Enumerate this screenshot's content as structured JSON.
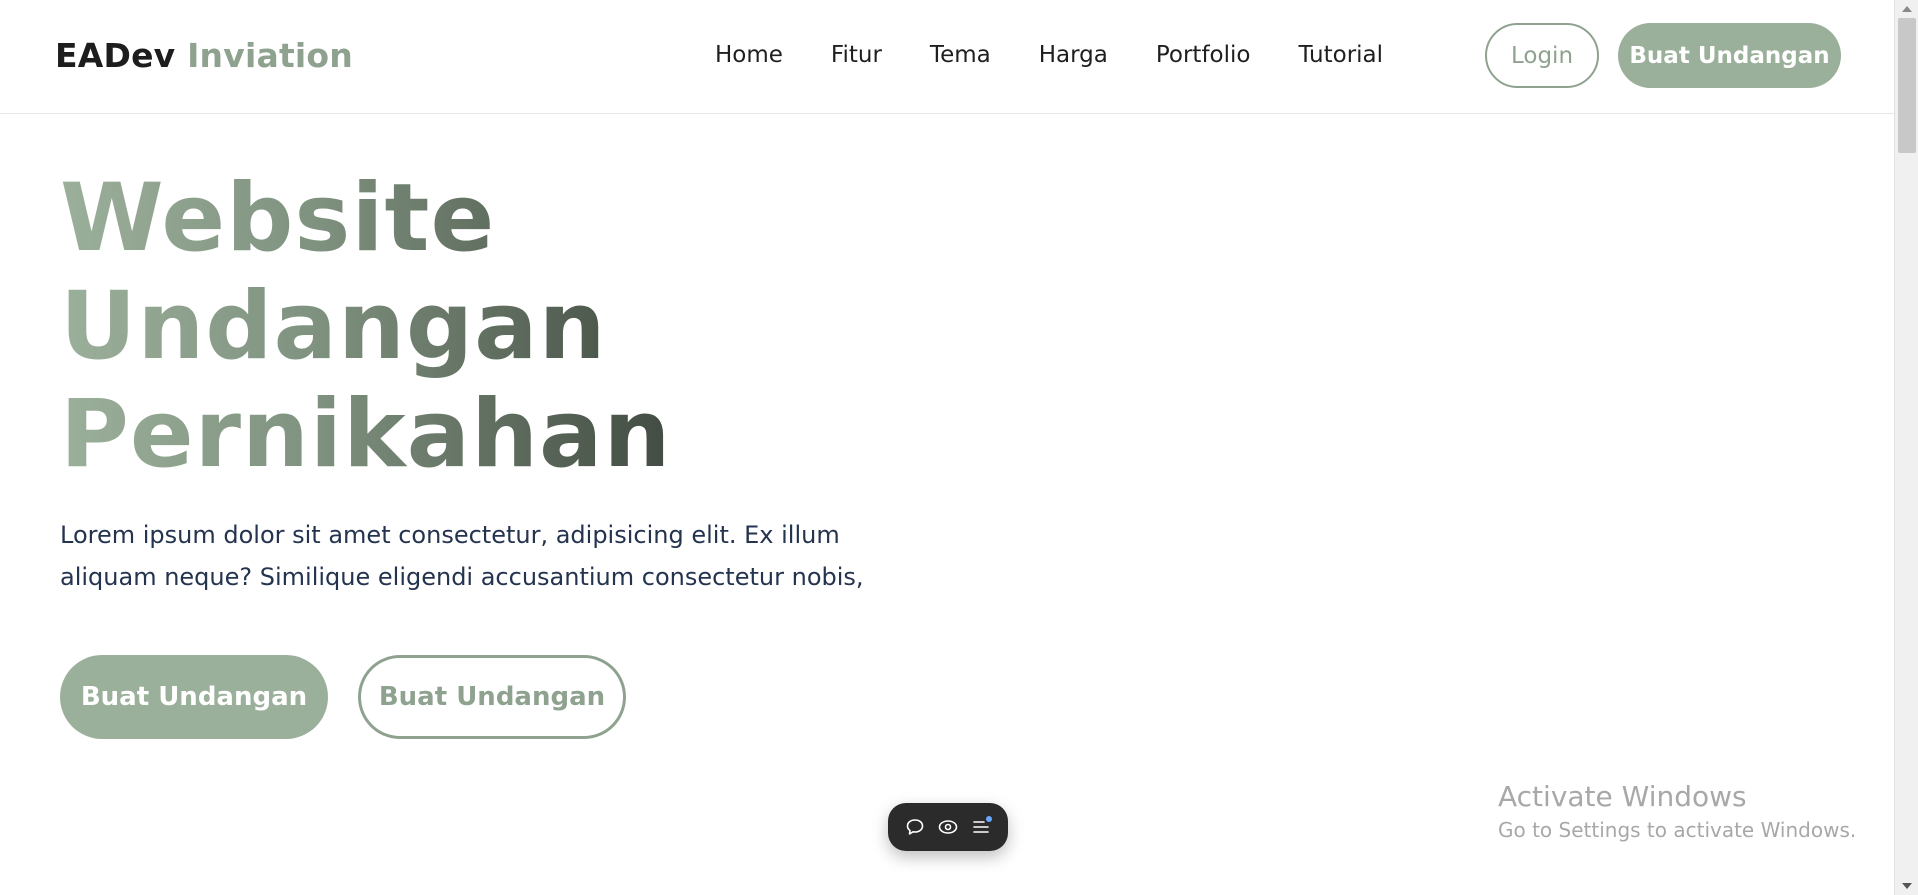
{
  "brand": {
    "name_main": "EADev",
    "name_accent": "Inviation"
  },
  "nav": {
    "items": [
      {
        "label": "Home"
      },
      {
        "label": "Fitur"
      },
      {
        "label": "Tema"
      },
      {
        "label": "Harga"
      },
      {
        "label": "Portfolio"
      },
      {
        "label": "Tutorial"
      }
    ],
    "login_label": "Login",
    "create_label": "Buat Undangan"
  },
  "hero": {
    "title_lines": [
      "Website",
      "Undangan",
      "Pernikahan"
    ],
    "description": "Lorem ipsum dolor sit amet consectetur, adipisicing elit. Ex illum aliquam neque? Similique eligendi accusantium consectetur nobis,",
    "primary_button": "Buat Undangan",
    "secondary_button": "Buat Undangan"
  },
  "floating_toolbar": {
    "icons": [
      "comment-icon",
      "eye-icon",
      "menu-list-icon"
    ]
  },
  "watermark": {
    "title": "Activate Windows",
    "subtitle": "Go to Settings to activate Windows."
  },
  "colors": {
    "accent": "#9bb09b",
    "accent_outline": "#8fa28f",
    "text_dark": "#1f1f1f",
    "text_desc": "#24344f",
    "toolbar_bg": "#2b2b2b"
  }
}
